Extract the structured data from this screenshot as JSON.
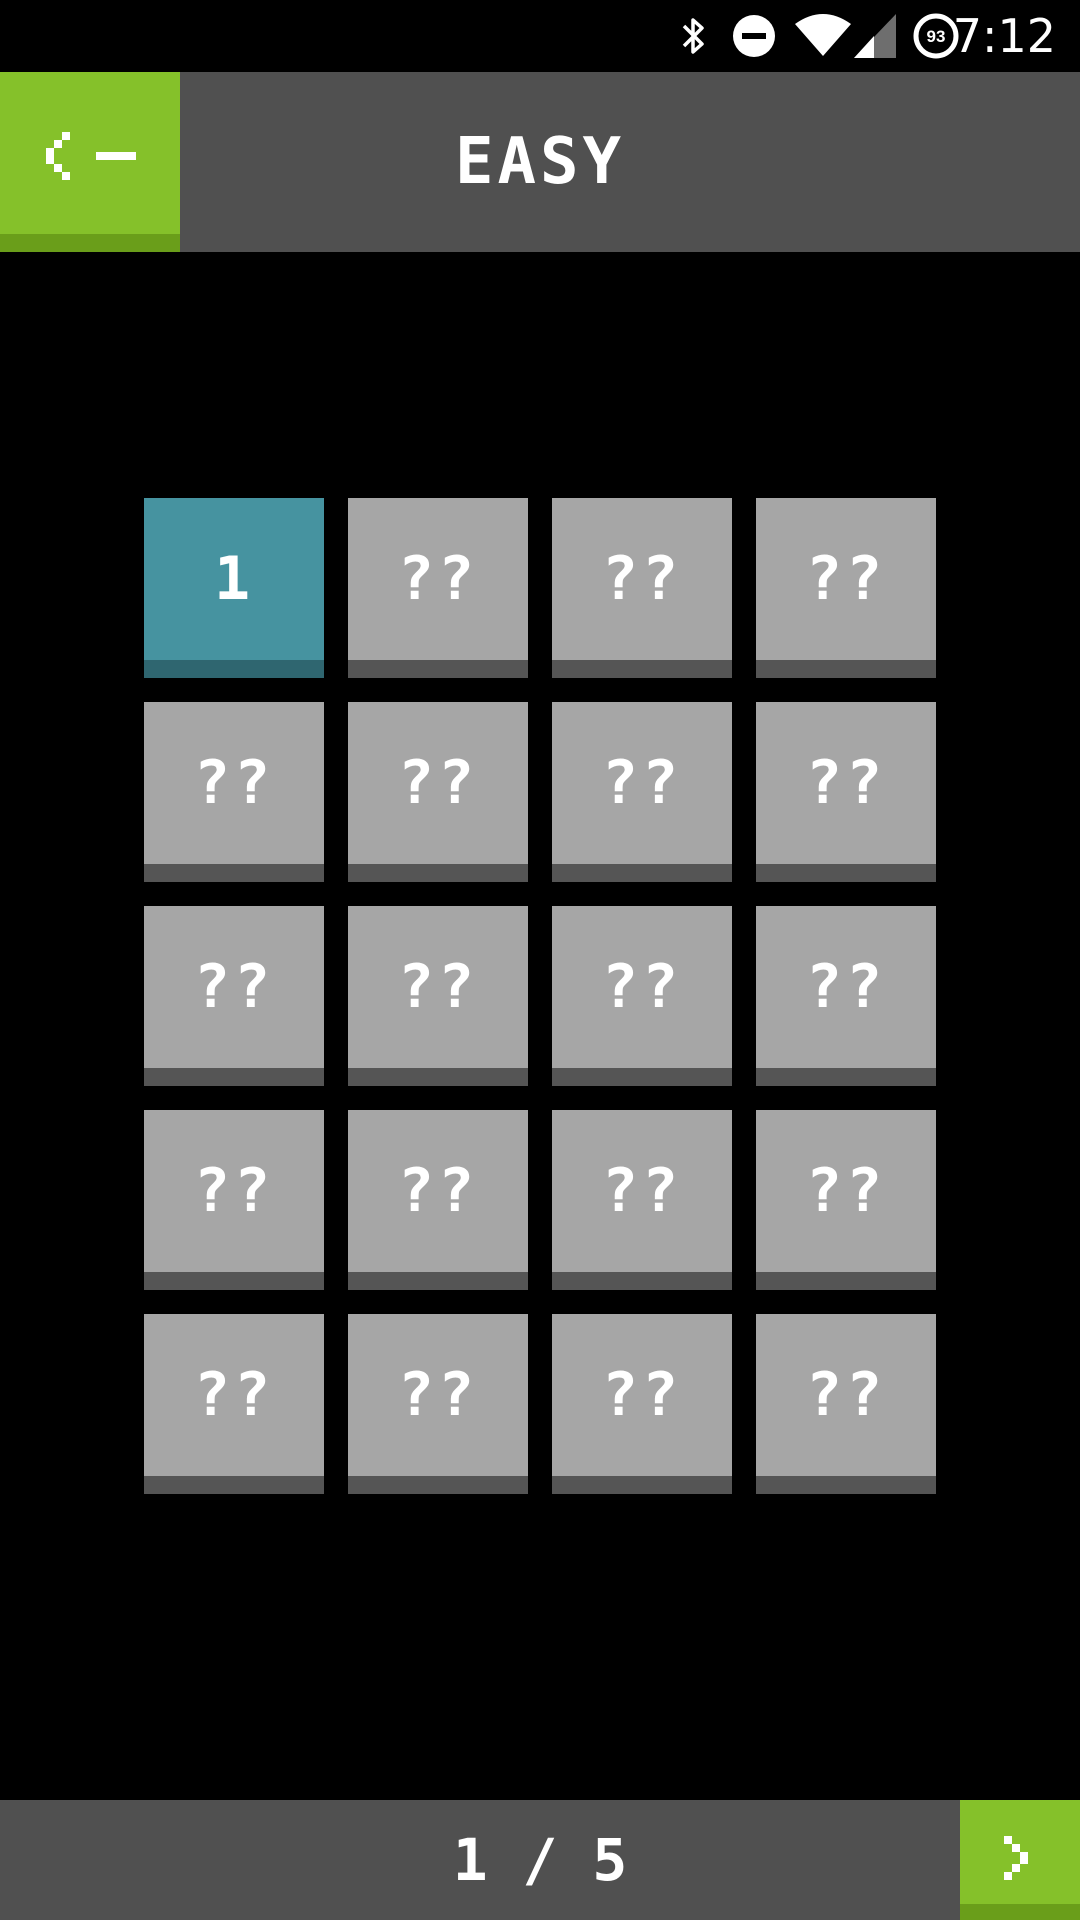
{
  "status_bar": {
    "time": "7:12",
    "battery_level": "93",
    "icons": [
      "bluetooth-icon",
      "do-not-disturb-icon",
      "wifi-icon",
      "cell-signal-icon",
      "battery-icon"
    ]
  },
  "header": {
    "back_icon": "back-arrow-icon",
    "title": "EASY"
  },
  "levels": [
    {
      "label": "1",
      "unlocked": true
    },
    {
      "label": "??",
      "unlocked": false
    },
    {
      "label": "??",
      "unlocked": false
    },
    {
      "label": "??",
      "unlocked": false
    },
    {
      "label": "??",
      "unlocked": false
    },
    {
      "label": "??",
      "unlocked": false
    },
    {
      "label": "??",
      "unlocked": false
    },
    {
      "label": "??",
      "unlocked": false
    },
    {
      "label": "??",
      "unlocked": false
    },
    {
      "label": "??",
      "unlocked": false
    },
    {
      "label": "??",
      "unlocked": false
    },
    {
      "label": "??",
      "unlocked": false
    },
    {
      "label": "??",
      "unlocked": false
    },
    {
      "label": "??",
      "unlocked": false
    },
    {
      "label": "??",
      "unlocked": false
    },
    {
      "label": "??",
      "unlocked": false
    },
    {
      "label": "??",
      "unlocked": false
    },
    {
      "label": "??",
      "unlocked": false
    },
    {
      "label": "??",
      "unlocked": false
    },
    {
      "label": "??",
      "unlocked": false
    }
  ],
  "footer": {
    "page_indicator": "1 / 5",
    "next_icon": "chevron-right-icon"
  },
  "colors": {
    "background": "#000000",
    "bar": "#505050",
    "accent_green": "#85c12a",
    "unlocked_tile": "#4693a0",
    "locked_tile": "#a6a6a6"
  }
}
